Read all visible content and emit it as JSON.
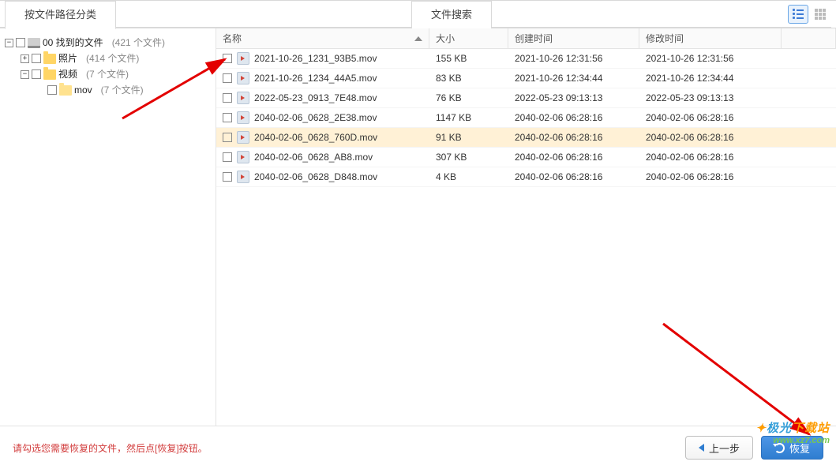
{
  "tabs": {
    "left": "按文件路径分类",
    "center": "文件搜索"
  },
  "view": {
    "list_tooltip": "list-view",
    "grid_tooltip": "grid-view"
  },
  "tree": {
    "root": {
      "label": "00 找到的文件",
      "count": "(421 个文件)"
    },
    "photos": {
      "label": "照片",
      "count": "(414 个文件)"
    },
    "videos": {
      "label": "视频",
      "count": "(7 个文件)"
    },
    "mov": {
      "label": "mov",
      "count": "(7 个文件)"
    }
  },
  "table": {
    "headers": {
      "name": "名称",
      "size": "大小",
      "created": "创建时间",
      "modified": "修改时间"
    },
    "rows": [
      {
        "name": "2021-10-26_1231_93B5.mov",
        "size": "155 KB",
        "ct": "2021-10-26  12:31:56",
        "mt": "2021-10-26  12:31:56",
        "sel": false
      },
      {
        "name": "2021-10-26_1234_44A5.mov",
        "size": "83 KB",
        "ct": "2021-10-26  12:34:44",
        "mt": "2021-10-26  12:34:44",
        "sel": false
      },
      {
        "name": "2022-05-23_0913_7E48.mov",
        "size": "76 KB",
        "ct": "2022-05-23  09:13:13",
        "mt": "2022-05-23  09:13:13",
        "sel": false
      },
      {
        "name": "2040-02-06_0628_2E38.mov",
        "size": "1147 KB",
        "ct": "2040-02-06  06:28:16",
        "mt": "2040-02-06  06:28:16",
        "sel": false
      },
      {
        "name": "2040-02-06_0628_760D.mov",
        "size": "91 KB",
        "ct": "2040-02-06  06:28:16",
        "mt": "2040-02-06  06:28:16",
        "sel": true
      },
      {
        "name": "2040-02-06_0628_AB8.mov",
        "size": "307 KB",
        "ct": "2040-02-06  06:28:16",
        "mt": "2040-02-06  06:28:16",
        "sel": false
      },
      {
        "name": "2040-02-06_0628_D848.mov",
        "size": "4 KB",
        "ct": "2040-02-06  06:28:16",
        "mt": "2040-02-06  06:28:16",
        "sel": false
      }
    ]
  },
  "footer": {
    "hint": "请勾选您需要恢复的文件，然后点[恢复]按钮。",
    "prev": "上一步",
    "recover": "恢复"
  },
  "watermark": {
    "line1a": "极光",
    "line1b": "下载站",
    "line2": "www.xz7.com"
  }
}
